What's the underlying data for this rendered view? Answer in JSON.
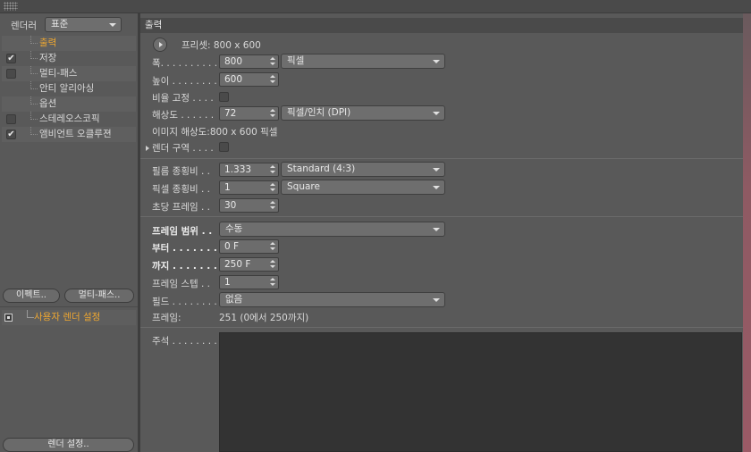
{
  "left": {
    "renderer_label": "렌더러",
    "renderer_value": "표준",
    "items": [
      {
        "label": "출력",
        "checkbox": false,
        "checked": false,
        "selected": true
      },
      {
        "label": "저장",
        "checkbox": true,
        "checked": true,
        "selected": false
      },
      {
        "label": "멀티-패스",
        "checkbox": true,
        "checked": false,
        "selected": false
      },
      {
        "label": "안티 알리아싱",
        "checkbox": false,
        "checked": false,
        "selected": false
      },
      {
        "label": "옵션",
        "checkbox": false,
        "checked": false,
        "selected": false
      },
      {
        "label": "스테레오스코픽",
        "checkbox": true,
        "checked": false,
        "selected": false
      },
      {
        "label": "앰비언트 오클루젼",
        "checkbox": true,
        "checked": true,
        "selected": false
      }
    ],
    "effects_button": "이펙트..",
    "multipass_button": "멀티-패스..",
    "render_setting_item": "사용자 렌더 설정",
    "render_settings_button": "렌더 설정..",
    "check_glyph": "✔"
  },
  "output": {
    "title": "출력",
    "preset": "프리셋: 800 x 600",
    "width_label": "폭. . . . . . . . . . .",
    "width_value": "800",
    "width_unit": "픽셀",
    "height_label": "높이 . . . . . . . . .",
    "height_value": "600",
    "lock_ratio_label": "비율 고정 . . . .",
    "resolution_label": "해상도 . . . . . .",
    "resolution_value": "72",
    "resolution_unit": "픽셀/인치 (DPI)",
    "image_resolution": "이미지 해상도:800 x 600 픽셀",
    "render_region_label": "렌더 구역 . . . .",
    "film_aspect_label": "필름 종횡비 . .",
    "film_aspect_value": "1.333",
    "film_aspect_preset": "Standard (4:3)",
    "pixel_aspect_label": "픽셀 종횡비 . .",
    "pixel_aspect_value": "1",
    "pixel_aspect_preset": "Square",
    "fps_label": "초당 프레임 . .",
    "fps_value": "30",
    "frame_range_label": "프레임 범위 . .",
    "frame_range_value": "수동",
    "from_label": "부터 . . . . . . . . .",
    "from_value": "0 F",
    "to_label": "까지 . . . . . . . . .",
    "to_value": "250 F",
    "frame_step_label": "프레임 스텝 . .",
    "frame_step_value": "1",
    "field_label": "필드 . . . . . . . . .",
    "field_value": "없음",
    "frames_label": "프레임:",
    "frames_value": "251 (0에서 250까지)",
    "notes_label": "주석 . . . . . . . ."
  }
}
